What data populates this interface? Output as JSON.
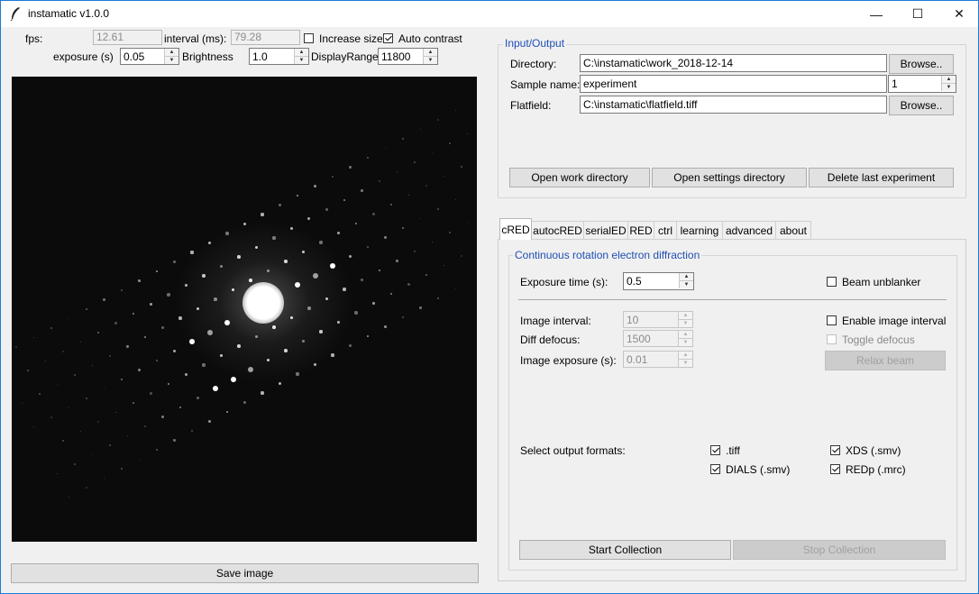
{
  "window": {
    "title": "instamatic v1.0.0",
    "min": "—",
    "max": "☐",
    "close": "✕"
  },
  "top": {
    "fps_label": "fps:",
    "fps_value": "12.61",
    "interval_label": "interval (ms):",
    "interval_value": "79.28",
    "increase_size_label": "Increase size",
    "increase_size_checked": false,
    "auto_contrast_label": "Auto contrast",
    "auto_contrast_checked": true,
    "exposure_label": "exposure (s)",
    "exposure_value": "0.05",
    "brightness_label": "Brightness",
    "brightness_value": "1.0",
    "display_range_label": "DisplayRange",
    "display_range_value": "11800"
  },
  "save_image_label": "Save image",
  "io": {
    "title": "Input/Output",
    "directory_label": "Directory:",
    "directory_value": "C:\\instamatic\\work_2018-12-14",
    "sample_label": "Sample name:",
    "sample_value": "experiment",
    "sample_number": "1",
    "flatfield_label": "Flatfield:",
    "flatfield_value": "C:\\instamatic\\flatfield.tiff",
    "browse_label": "Browse..",
    "open_work": "Open work directory",
    "open_settings": "Open settings directory",
    "delete_last": "Delete last experiment"
  },
  "tabs": [
    "cRED",
    "autocRED",
    "serialED",
    "RED",
    "ctrl",
    "learning",
    "advanced",
    "about"
  ],
  "cred": {
    "title": "Continuous rotation electron diffraction",
    "exposure_label": "Exposure time (s):",
    "exposure_value": "0.5",
    "beam_unblanker": "Beam unblanker",
    "image_interval_label": "Image interval:",
    "image_interval_value": "10",
    "diff_defocus_label": "Diff defocus:",
    "diff_defocus_value": "1500",
    "image_exposure_label": "Image exposure (s):",
    "image_exposure_value": "0.01",
    "enable_image_interval": "Enable image interval",
    "toggle_defocus": "Toggle defocus",
    "relax_beam": "Relax beam",
    "output_label": "Select output formats:",
    "formats": [
      ".tiff",
      "XDS (.smv)",
      "DIALS (.smv)",
      "REDp (.mrc)"
    ],
    "start": "Start Collection",
    "stop": "Stop Collection"
  },
  "icons": {
    "app": "feather-icon",
    "arrow_up": "▲",
    "arrow_down": "▼"
  },
  "colors": {
    "accent": "#1f4fb4",
    "window_border": "#1b7ad6"
  }
}
